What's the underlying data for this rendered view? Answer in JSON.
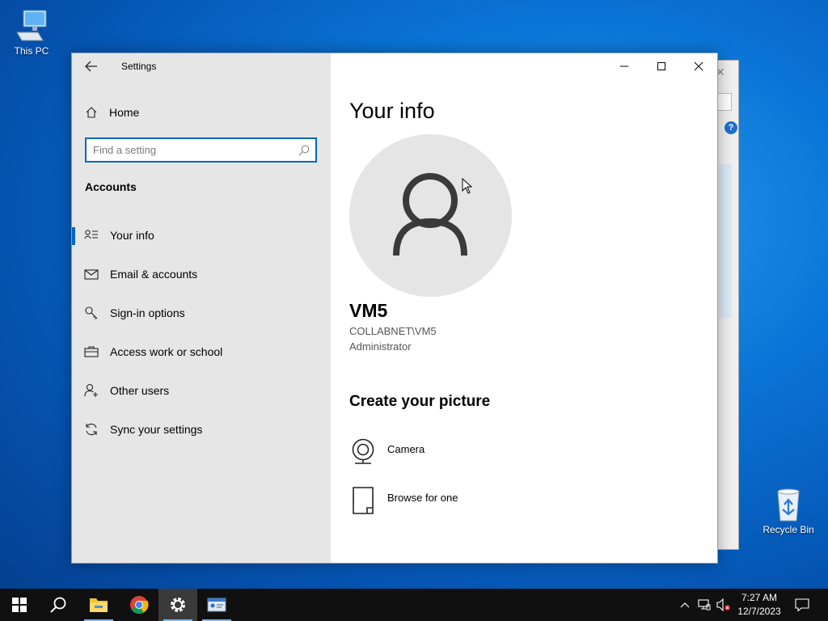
{
  "desktop": {
    "icons": [
      {
        "label": "This PC",
        "icon": "this-pc-icon"
      },
      {
        "label": "Recycle Bin",
        "icon": "recycle-bin-icon"
      }
    ]
  },
  "background_dialog": {
    "help_label": "?"
  },
  "settings": {
    "app_title": "Settings",
    "home_label": "Home",
    "search": {
      "placeholder": "Find a setting",
      "value": ""
    },
    "section": "Accounts",
    "nav": [
      {
        "label": "Your info",
        "icon": "person-list-icon",
        "active": true
      },
      {
        "label": "Email & accounts",
        "icon": "mail-icon",
        "active": false
      },
      {
        "label": "Sign-in options",
        "icon": "key-icon",
        "active": false
      },
      {
        "label": "Access work or school",
        "icon": "briefcase-icon",
        "active": false
      },
      {
        "label": "Other users",
        "icon": "person-add-icon",
        "active": false
      },
      {
        "label": "Sync your settings",
        "icon": "sync-icon",
        "active": false
      }
    ]
  },
  "content": {
    "page_title": "Your info",
    "user": {
      "name": "VM5",
      "domain": "COLLABNET\\VM5",
      "role": "Administrator"
    },
    "create_picture_title": "Create your picture",
    "options": [
      {
        "label": "Camera",
        "icon": "camera-icon"
      },
      {
        "label": "Browse for one",
        "icon": "browse-file-icon"
      }
    ]
  },
  "taskbar": {
    "apps": [
      "start-icon",
      "search-icon",
      "file-explorer-icon",
      "chrome-icon",
      "settings-gear-icon",
      "control-panel-icon"
    ],
    "time": "7:27 AM",
    "date": "12/7/2023"
  },
  "colors": {
    "accent": "#0067c0",
    "sidebar_bg": "#e6e6e6",
    "taskbar_bg": "#101010"
  }
}
